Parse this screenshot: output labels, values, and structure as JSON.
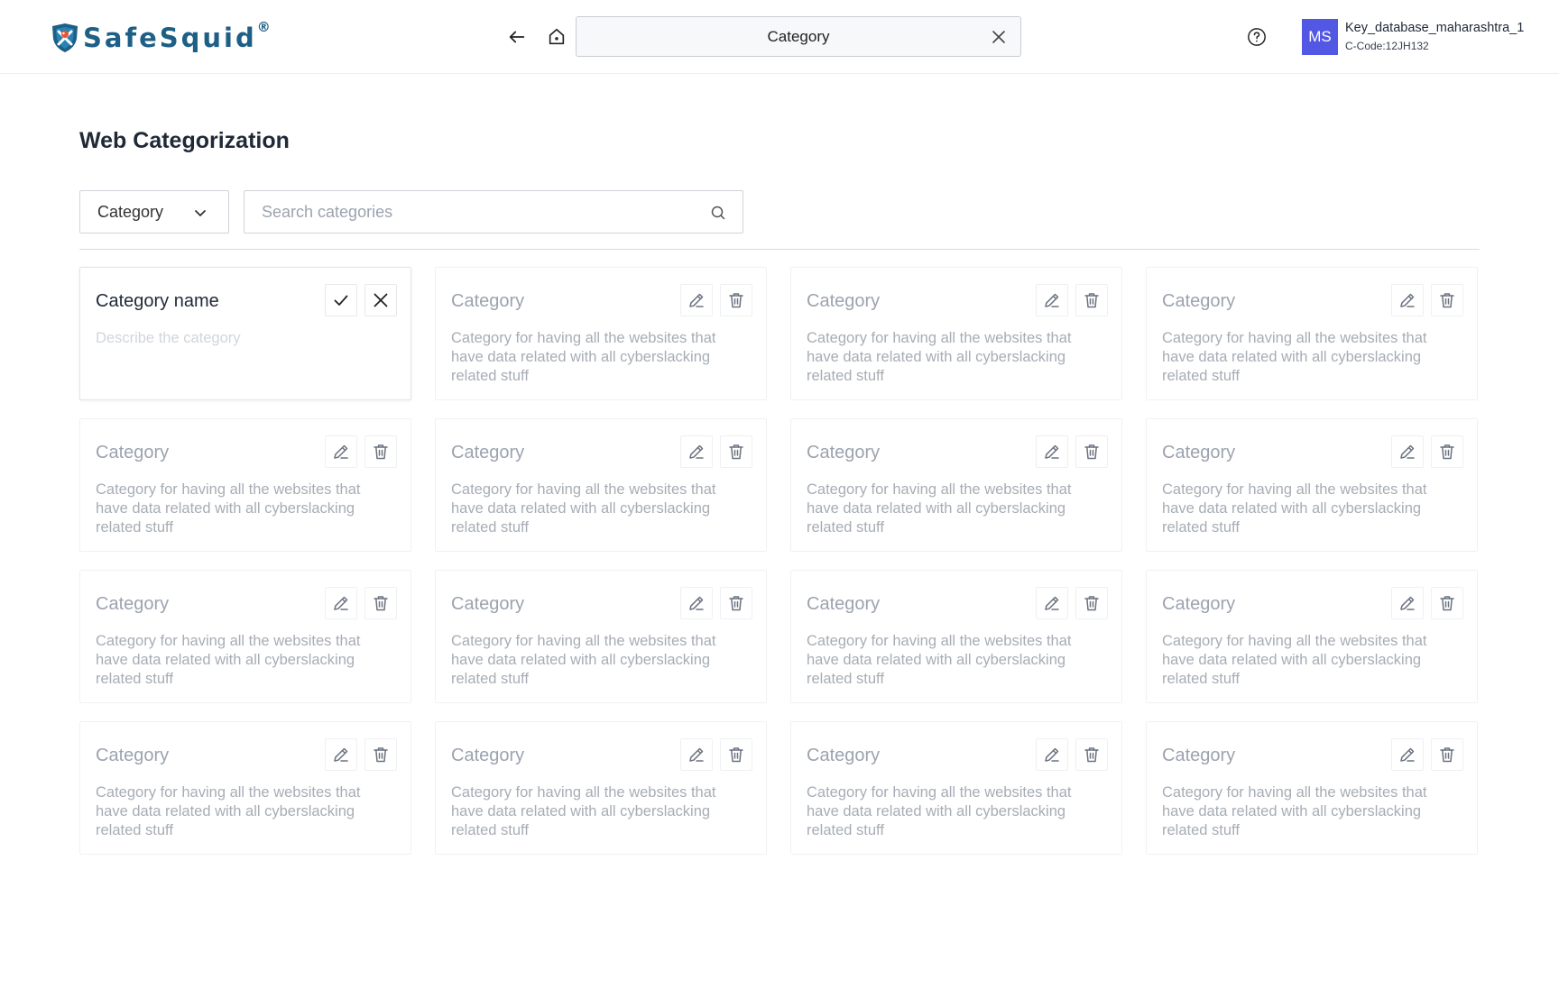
{
  "header": {
    "logo_text": "SafeSquid",
    "logo_reg": "®",
    "breadcrumb_search_value": "Category",
    "avatar_initials": "MS",
    "account_name": "Key_database_maharashtra_1",
    "account_code": "C-Code:12JH132",
    "icons": {
      "back": "arrow-left-icon",
      "home": "home-icon",
      "clear": "close-icon",
      "help": "question-circle-icon"
    }
  },
  "page": {
    "title": "Web Categorization",
    "filter": {
      "selected": "Category"
    },
    "search": {
      "placeholder": "Search categories",
      "value": ""
    }
  },
  "editing_card": {
    "title": "Category name",
    "description_placeholder": "Describe the category",
    "icons": [
      "check-icon",
      "close-icon"
    ]
  },
  "cards": [
    {
      "title": "Category",
      "description": "Category for having all the websites that have data related with all cyberslacking related stuff"
    },
    {
      "title": "Category",
      "description": "Category for having all the websites that have data related with all cyberslacking related stuff"
    },
    {
      "title": "Category",
      "description": "Category for having all the websites that have data related with all cyberslacking related stuff"
    },
    {
      "title": "Category",
      "description": "Category for having all the websites that have data related with all cyberslacking related stuff"
    },
    {
      "title": "Category",
      "description": "Category for having all the websites that have data related with all cyberslacking related stuff"
    },
    {
      "title": "Category",
      "description": "Category for having all the websites that have data related with all cyberslacking related stuff"
    },
    {
      "title": "Category",
      "description": "Category for having all the websites that have data related with all cyberslacking related stuff"
    },
    {
      "title": "Category",
      "description": "Category for having all the websites that have data related with all cyberslacking related stuff"
    },
    {
      "title": "Category",
      "description": "Category for having all the websites that have data related with all cyberslacking related stuff"
    },
    {
      "title": "Category",
      "description": "Category for having all the websites that have data related with all cyberslacking related stuff"
    },
    {
      "title": "Category",
      "description": "Category for having all the websites that have data related with all cyberslacking related stuff"
    },
    {
      "title": "Category",
      "description": "Category for having all the websites that have data related with all cyberslacking related stuff"
    },
    {
      "title": "Category",
      "description": "Category for having all the websites that have data related with all cyberslacking related stuff"
    },
    {
      "title": "Category",
      "description": "Category for having all the websites that have data related with all cyberslacking related stuff"
    },
    {
      "title": "Category",
      "description": "Category for having all the websites that have data related with all cyberslacking related stuff"
    }
  ],
  "colors": {
    "brand": "#1d5f86",
    "avatar": "#5258e4",
    "muted_text": "#9ca3af"
  }
}
